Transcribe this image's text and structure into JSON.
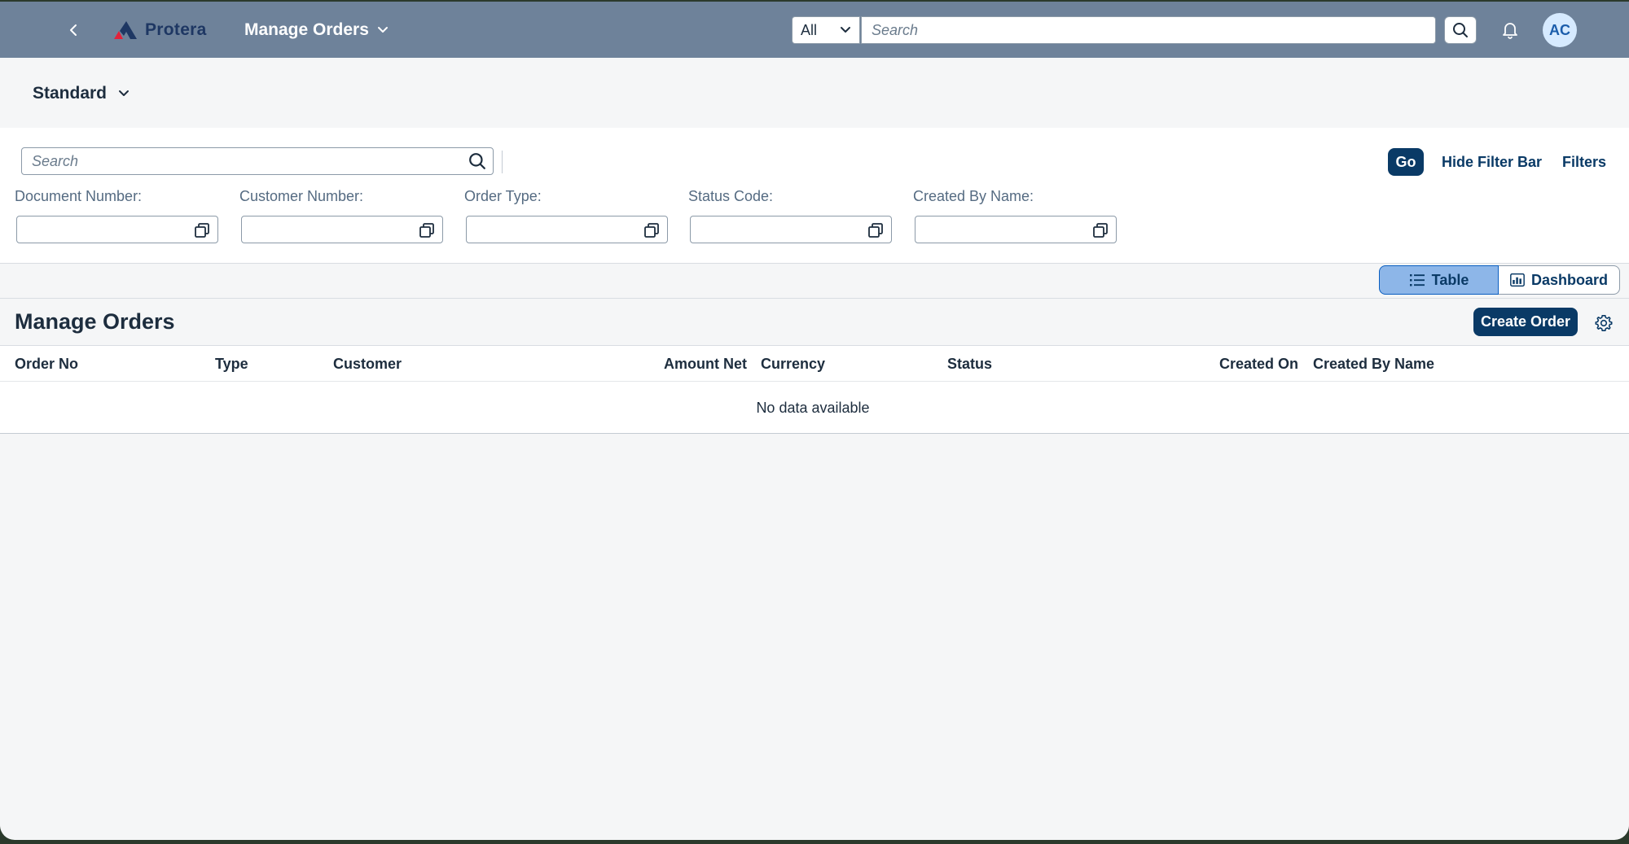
{
  "shell": {
    "logo_text": "Protera",
    "app_title": "Manage Orders",
    "scope_value": "All",
    "search_placeholder": "Search",
    "avatar_initials": "AC"
  },
  "variant": {
    "label": "Standard"
  },
  "filterbar": {
    "search_placeholder": "Search",
    "go_label": "Go",
    "hide_label": "Hide Filter Bar",
    "filters_label": "Filters",
    "fields": [
      {
        "label": "Document Number:",
        "value": ""
      },
      {
        "label": "Customer Number:",
        "value": ""
      },
      {
        "label": "Order Type:",
        "value": ""
      },
      {
        "label": "Status Code:",
        "value": ""
      },
      {
        "label": "Created By Name:",
        "value": ""
      }
    ]
  },
  "view_switch": {
    "table_label": "Table",
    "dashboard_label": "Dashboard",
    "selected": "Table"
  },
  "table": {
    "title": "Manage Orders",
    "create_label": "Create Order",
    "columns": [
      "Order No",
      "Type",
      "Customer",
      "Amount Net",
      "Currency",
      "Status",
      "Created On",
      "Created By Name"
    ],
    "empty_text": "No data available",
    "rows": []
  },
  "colors": {
    "shell_bg": "#6e829a",
    "primary_button": "#0a3a66",
    "selected_segment": "#8db6e8",
    "logo_accent": "#e3223a"
  }
}
